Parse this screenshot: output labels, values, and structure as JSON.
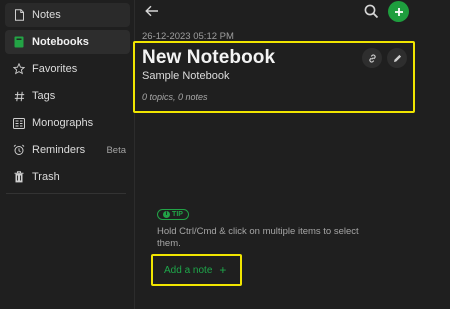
{
  "sidebar": {
    "items": [
      {
        "label": "Notes",
        "icon": "note-icon"
      },
      {
        "label": "Notebooks",
        "icon": "notebook-icon",
        "active": true
      },
      {
        "label": "Favorites",
        "icon": "star-icon"
      },
      {
        "label": "Tags",
        "icon": "hash-icon"
      },
      {
        "label": "Monographs",
        "icon": "monograph-icon"
      },
      {
        "label": "Reminders",
        "icon": "alarm-icon",
        "badge": "Beta"
      },
      {
        "label": "Trash",
        "icon": "trash-icon"
      }
    ]
  },
  "main": {
    "date": "26-12-2023 05:12 PM",
    "notebook": {
      "title": "New Notebook",
      "description": "Sample Notebook",
      "meta": "0 topics, 0 notes"
    },
    "tip": {
      "badge": "TIP",
      "text": "Hold Ctrl/Cmd & click on multiple items to select them."
    },
    "add_note_label": "Add a note",
    "add_note_plus": "+"
  },
  "colors": {
    "accent": "#1e9e3e",
    "highlight": "#f0e500",
    "background": "#1f1f1f"
  }
}
